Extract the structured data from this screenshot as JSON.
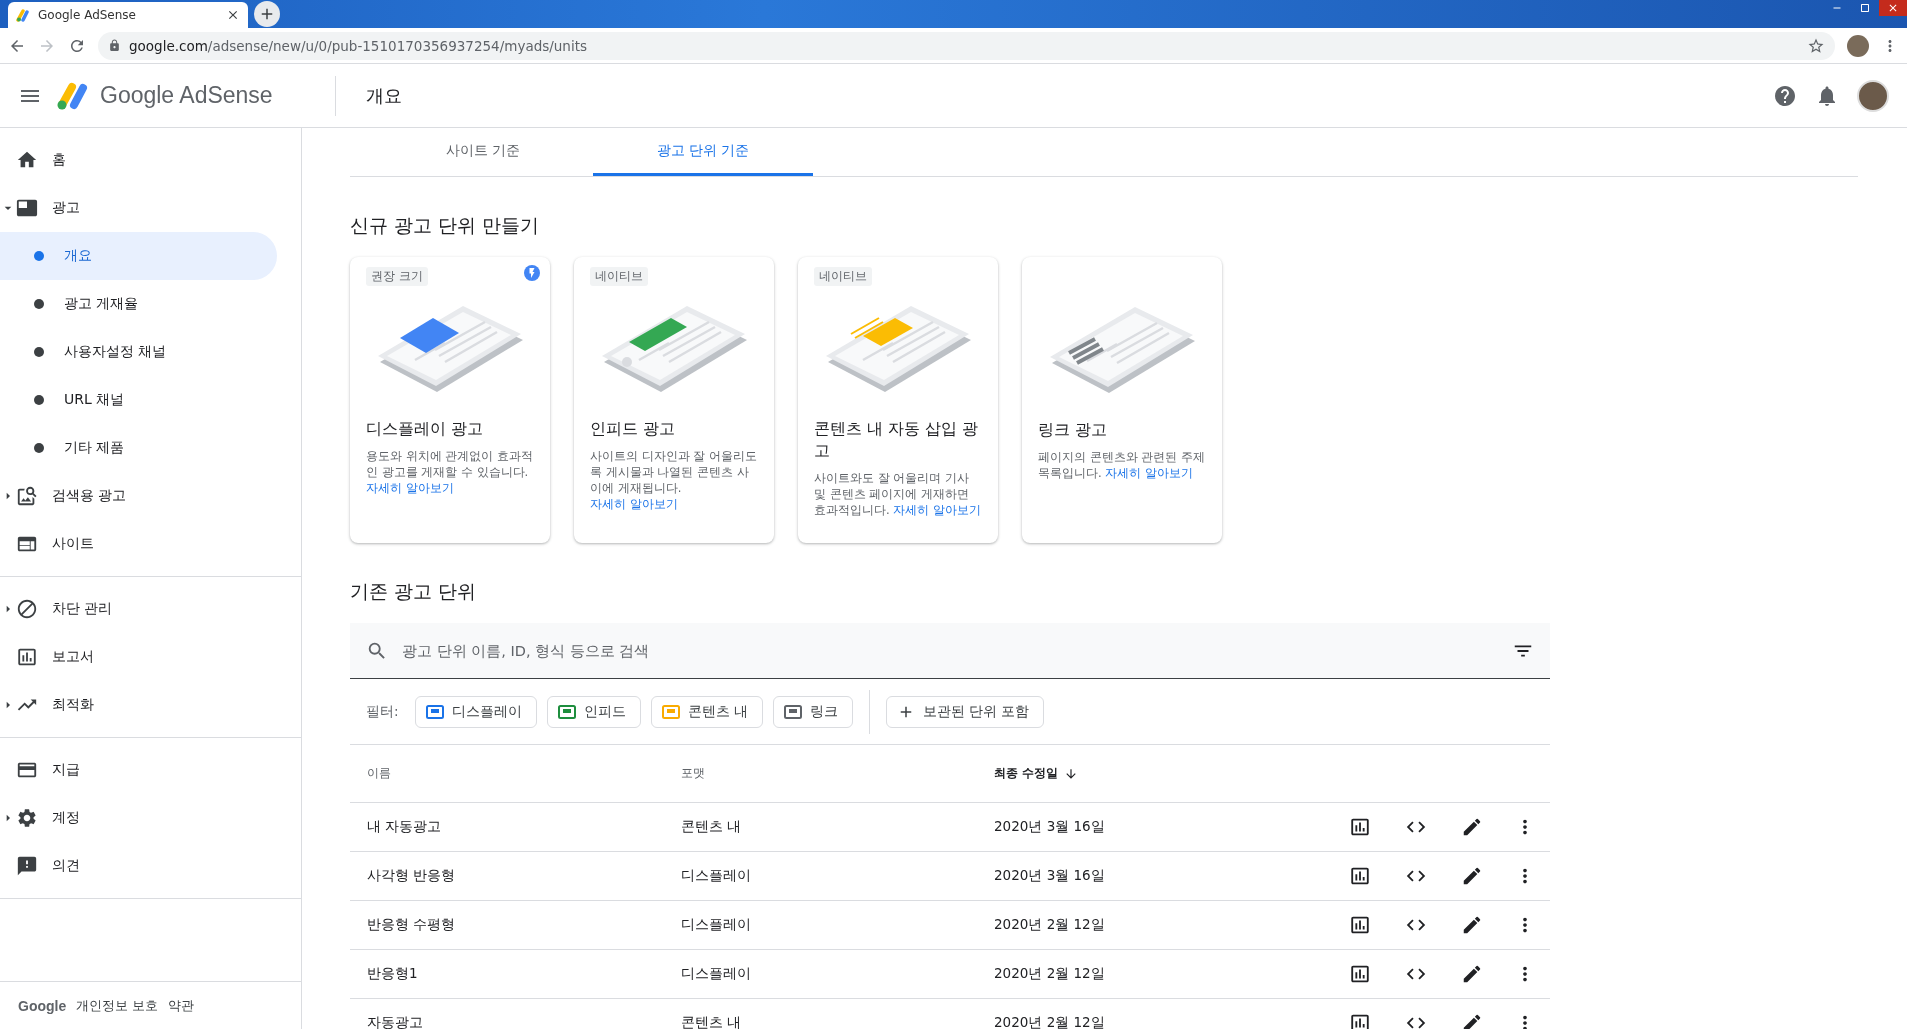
{
  "browser": {
    "tab_title": "Google AdSense",
    "url_host": "google.com",
    "url_path": "/adsense/new/u/0/pub-1510170356937254/myads/units"
  },
  "header": {
    "product": "Google AdSense",
    "page_title": "개요"
  },
  "sidebar": {
    "sections": [
      {
        "items": [
          {
            "label": "홈"
          },
          {
            "label": "광고",
            "expanded": true,
            "children": [
              {
                "label": "개요",
                "selected": true
              },
              {
                "label": "광고 게재율",
                "selected": false
              },
              {
                "label": "사용자설정 채널",
                "selected": false
              },
              {
                "label": "URL 채널",
                "selected": false
              },
              {
                "label": "기타 제품",
                "selected": false
              }
            ]
          },
          {
            "label": "검색용 광고",
            "expanded": false
          },
          {
            "label": "사이트"
          }
        ]
      },
      {
        "items": [
          {
            "label": "차단 관리",
            "expanded": false
          },
          {
            "label": "보고서"
          },
          {
            "label": "최적화",
            "expanded": false
          }
        ]
      },
      {
        "items": [
          {
            "label": "지급"
          },
          {
            "label": "계정",
            "expanded": false
          },
          {
            "label": "의견"
          }
        ]
      }
    ],
    "footer": {
      "brand": "Google",
      "links": [
        "개인정보 보호",
        "약관"
      ]
    }
  },
  "tabs": [
    {
      "label": "사이트 기준",
      "selected": false
    },
    {
      "label": "광고 단위 기준",
      "selected": true
    }
  ],
  "create": {
    "title": "신규 광고 단위 만들기",
    "cards": [
      {
        "kind": "display",
        "badge": "권장 크기",
        "featured": true,
        "title": "디스플레이 광고",
        "description": "용도와 위치에 관계없이 효과적인 광고를 게재할 수 있습니다.",
        "link": "자세히 알아보기"
      },
      {
        "kind": "infeed",
        "badge": "네이티브",
        "featured": false,
        "title": "인피드 광고",
        "description": "사이트의 디자인과 잘 어울리도록 게시물과 나열된 콘텐츠 사이에 게재됩니다.",
        "link": "자세히 알아보기"
      },
      {
        "kind": "incontent",
        "badge": "네이티브",
        "featured": false,
        "title": "콘텐츠 내 자동 삽입 광고",
        "description": "사이트와도 잘 어울리며 기사 및 콘텐츠 페이지에 게재하면 효과적입니다.",
        "link": "자세히 알아보기"
      },
      {
        "kind": "link",
        "featured": false,
        "title": "링크 광고",
        "description": "페이지의 콘텐츠와 관련된 주제 목록입니다.",
        "link": "자세히 알아보기"
      }
    ]
  },
  "existing": {
    "title": "기존 광고 단위",
    "search": {
      "placeholder": "광고 단위 이름, ID, 형식 등으로 검색"
    },
    "filter_label": "필터:",
    "chips": [
      {
        "label": "디스플레이",
        "color": "#1a73e8"
      },
      {
        "label": "인피드",
        "color": "#1e8e3e"
      },
      {
        "label": "콘텐츠 내",
        "color": "#f9ab00"
      },
      {
        "label": "링크",
        "color": "#5f6368"
      }
    ],
    "archived_chip": "보관된 단위 포함",
    "columns": [
      {
        "label": "이름",
        "sorted": false
      },
      {
        "label": "포맷",
        "sorted": false
      },
      {
        "label": "최종 수정일",
        "sorted": true
      }
    ],
    "rows": [
      {
        "name": "내 자동광고",
        "format": "콘텐츠 내",
        "modified": "2020년 3월 16일"
      },
      {
        "name": "사각형 반응형",
        "format": "디스플레이",
        "modified": "2020년 3월 16일"
      },
      {
        "name": "반응형 수평형",
        "format": "디스플레이",
        "modified": "2020년 2월 12일"
      },
      {
        "name": "반응형1",
        "format": "디스플레이",
        "modified": "2020년 2월 12일"
      },
      {
        "name": "자동광고",
        "format": "콘텐츠 내",
        "modified": "2020년 2월 12일"
      }
    ]
  }
}
